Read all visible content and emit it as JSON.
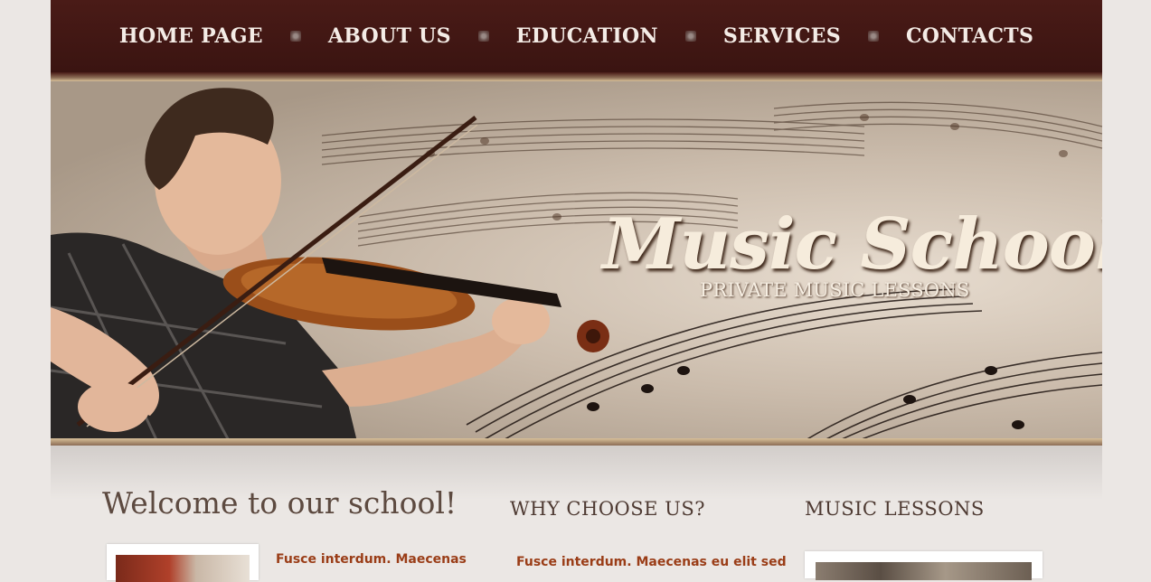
{
  "nav": {
    "items": [
      {
        "label": "HOME PAGE"
      },
      {
        "label": "ABOUT US"
      },
      {
        "label": "EDUCATION"
      },
      {
        "label": "SERVICES"
      },
      {
        "label": "CONTACTS"
      }
    ]
  },
  "hero": {
    "title": "Music School",
    "subtitle": "PRIVATE MUSIC LESSONS"
  },
  "content": {
    "welcome_title": "Welcome to our school!",
    "welcome_snippet": "Fusce interdum. Maecenas",
    "why_title": "WHY CHOOSE US?",
    "why_snippet": "Fusce interdum. Maecenas eu elit sed",
    "lessons_title": "MUSIC LESSONS"
  },
  "colors": {
    "nav_bg": "#4a1b17",
    "accent_text": "#9a3d17",
    "page_bg": "#ebe7e4"
  }
}
